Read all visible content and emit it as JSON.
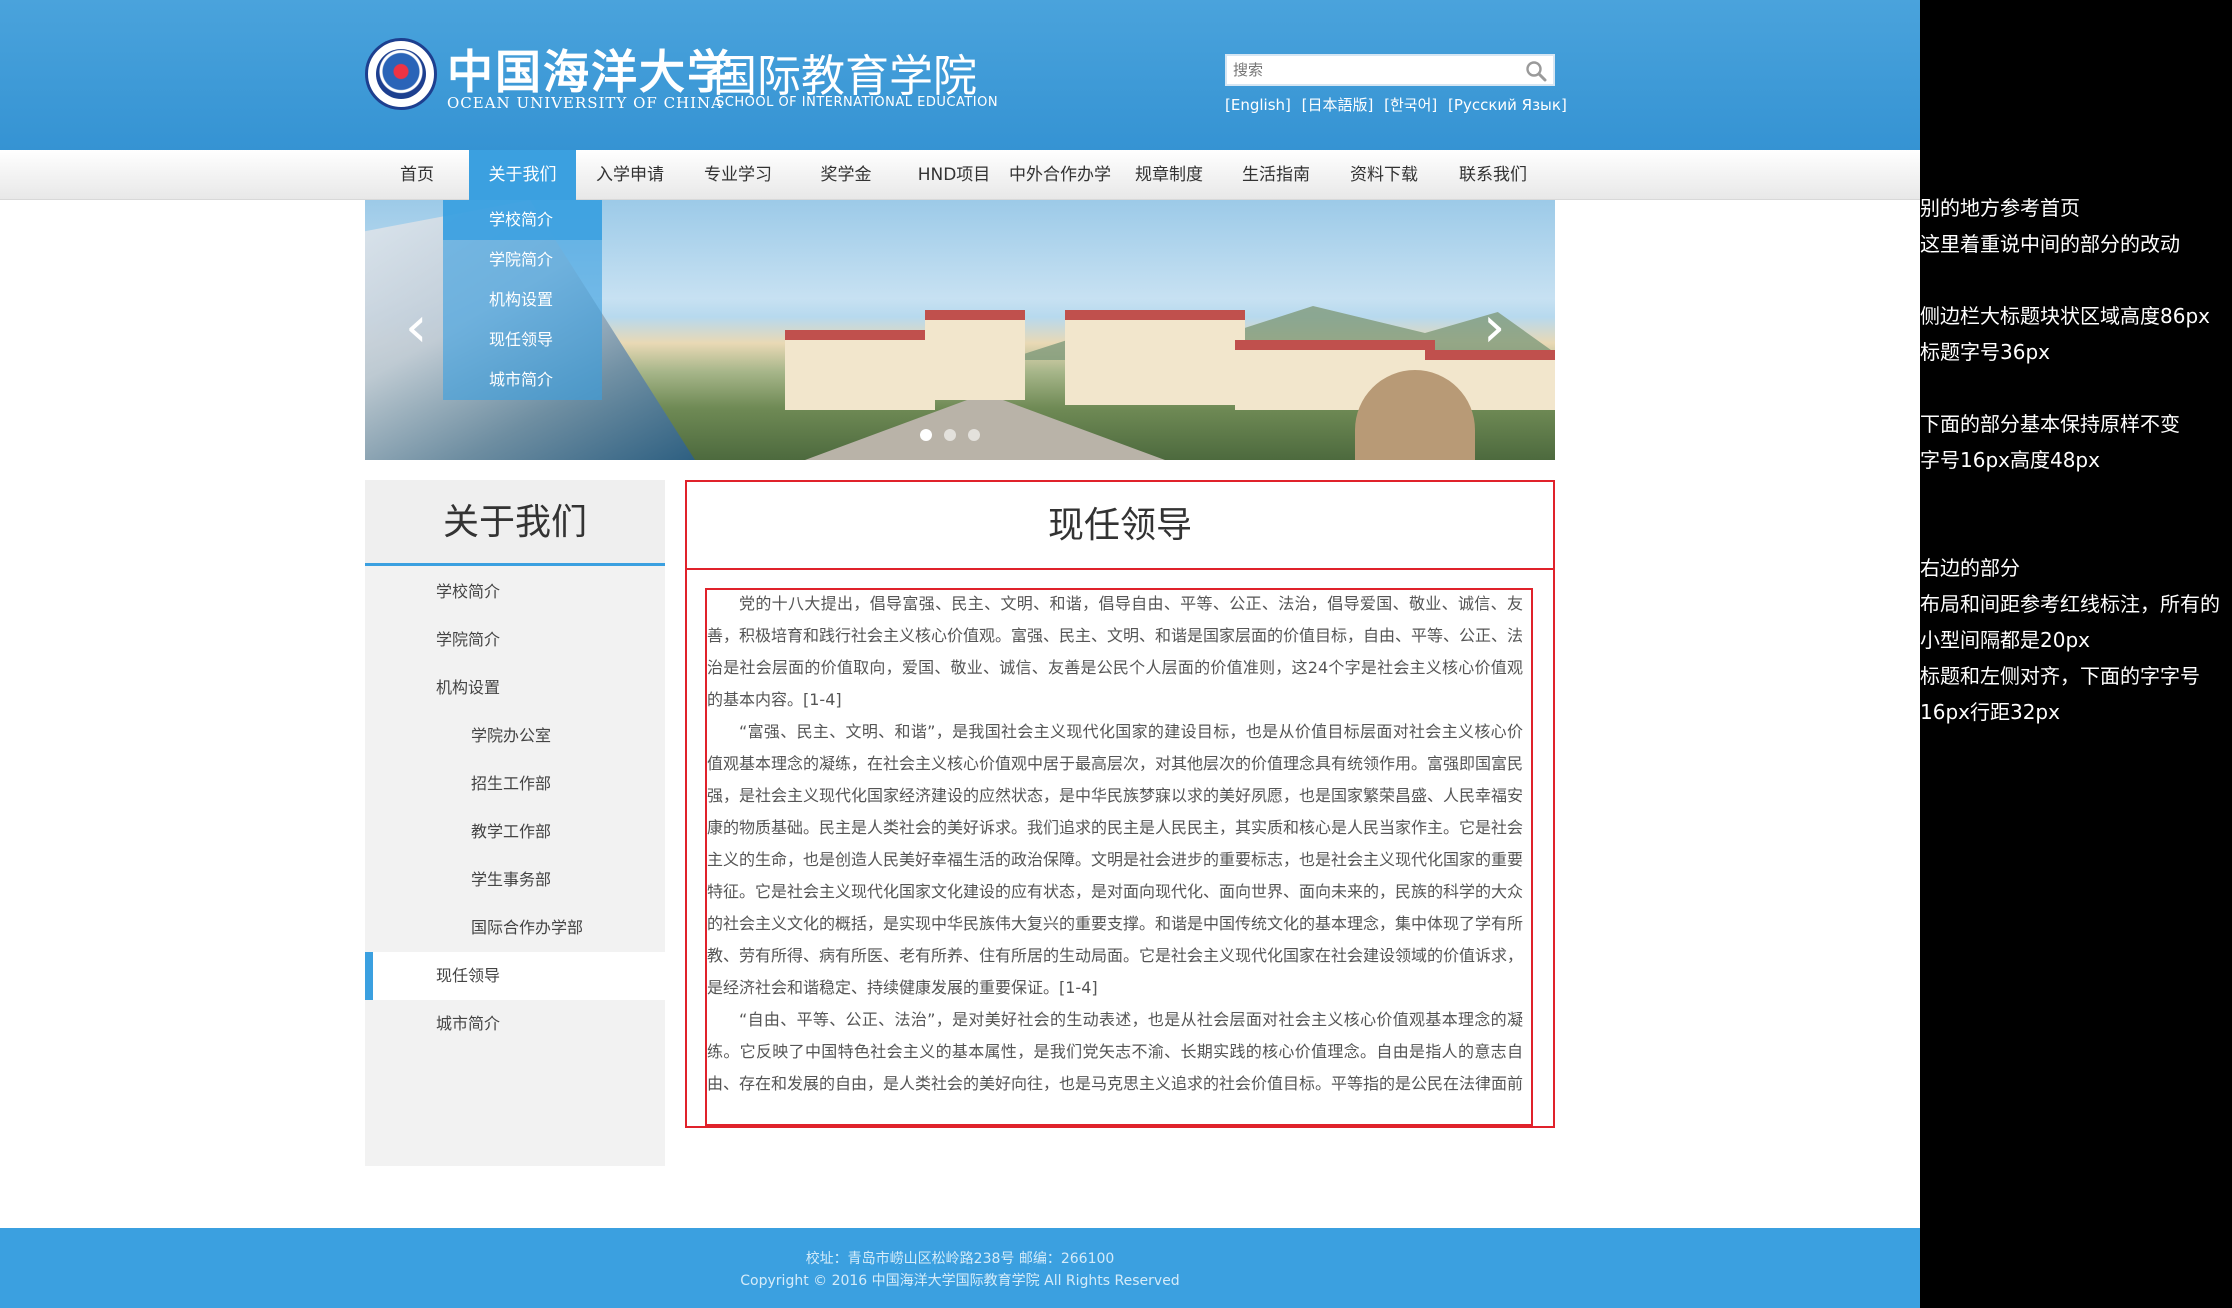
{
  "header": {
    "logo_cn": "中国海洋大学",
    "logo_en": "OCEAN UNIVERSITY OF CHINA",
    "school_cn": "国际教育学院",
    "school_en": "SCHOOL OF INTERNATIONAL EDUCATION",
    "search_placeholder": "搜索",
    "languages": [
      "[English]",
      "[日本語版]",
      "[한국어]",
      "[Русский Язык]"
    ]
  },
  "nav": {
    "items": [
      "首页",
      "关于我们",
      "入学申请",
      "专业学习",
      "奖学金",
      "HND项目",
      "中外合作办学",
      "规章制度",
      "生活指南",
      "资料下载",
      "联系我们"
    ],
    "active": "关于我们"
  },
  "dropdown": {
    "items": [
      "学校简介",
      "学院简介",
      "机构设置",
      "现任领导",
      "城市简介"
    ]
  },
  "banner": {
    "prev": "‹",
    "next": "›",
    "slide_count": 3,
    "active_slide": 1
  },
  "sidebar": {
    "title": "关于我们",
    "items": [
      "学校简介",
      "学院简介",
      "机构设置",
      "学院办公室",
      "招生工作部",
      "教学工作部",
      "学生事务部",
      "国际合作办学部",
      "现任领导",
      "城市简介"
    ],
    "active": "现任领导"
  },
  "content": {
    "title": "现任领导",
    "paragraphs": [
      "党的十八大提出，倡导富强、民主、文明、和谐，倡导自由、平等、公正、法治，倡导爱国、敬业、诚信、友善，积极培育和践行社会主义核心价值观。富强、民主、文明、和谐是国家层面的价值目标，自由、平等、公正、法治是社会层面的价值取向，爱国、敬业、诚信、友善是公民个人层面的价值准则，这24个字是社会主义核心价值观的基本内容。[1-4]",
      "“富强、民主、文明、和谐”，是我国社会主义现代化国家的建设目标，也是从价值目标层面对社会主义核心价值观基本理念的凝练，在社会主义核心价值观中居于最高层次，对其他层次的价值理念具有统领作用。富强即国富民强，是社会主义现代化国家经济建设的应然状态，是中华民族梦寐以求的美好夙愿，也是国家繁荣昌盛、人民幸福安康的物质基础。民主是人类社会的美好诉求。我们追求的民主是人民民主，其实质和核心是人民当家作主。它是社会主义的生命，也是创造人民美好幸福生活的政治保障。文明是社会进步的重要标志，也是社会主义现代化国家的重要特征。它是社会主义现代化国家文化建设的应有状态，是对面向现代化、面向世界、面向未来的，民族的科学的大众的社会主义文化的概括，是实现中华民族伟大复兴的重要支撑。和谐是中国传统文化的基本理念，集中体现了学有所教、劳有所得、病有所医、老有所养、住有所居的生动局面。它是社会主义现代化国家在社会建设领域的价值诉求，是经济社会和谐稳定、持续健康发展的重要保证。[1-4]",
      "“自由、平等、公正、法治”，是对美好社会的生动表述，也是从社会层面对社会主义核心价值观基本理念的凝练。它反映了中国特色社会主义的基本属性，是我们党矢志不渝、长期实践的核心价值理念。自由是指人的意志自由、存在和发展的自由，是人类社会的美好向往，也是马克思主义追求的社会价值目标。平等指的是公民在法律面前的"
    ]
  },
  "notes": [
    "别的地方参考首页",
    "这里着重说中间的部分的改动",
    "侧边栏大标题块状区域高度86px",
    "标题字号36px",
    "下面的部分基本保持原样不变",
    "字号16px高度48px",
    "右边的部分",
    "布局和间距参考红线标注，所有的",
    "小型间隔都是20px",
    "标题和左侧对齐，下面的字字号",
    "16px行距32px"
  ],
  "footer": {
    "address": "校址：青岛市崂山区松岭路238号  邮编：266100",
    "copyright": "Copyright © 2016 中国海洋大学国际教育学院  All Rights Reserved"
  },
  "colors": {
    "brand_blue": "#3ba0e0",
    "annotation_red": "#e0222b",
    "notes_bg": "#000000"
  }
}
